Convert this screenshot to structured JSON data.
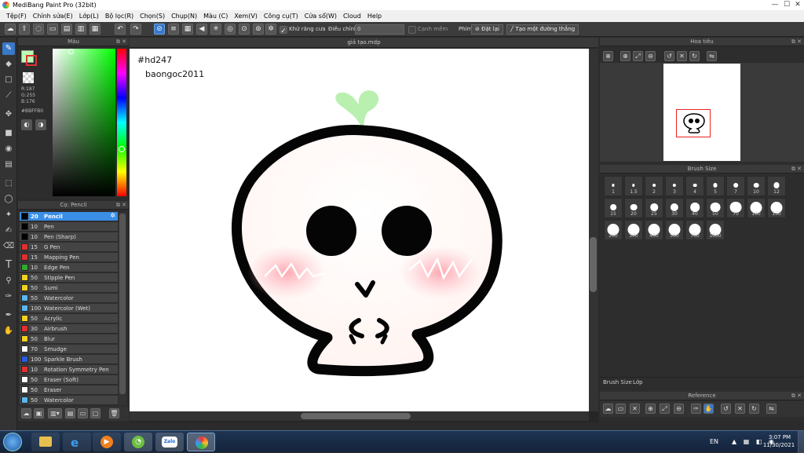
{
  "window": {
    "title": "MediBang Paint Pro (32bit)",
    "controls": [
      "—",
      "☐",
      "✕"
    ]
  },
  "menu": [
    "Tệp(F)",
    "Chỉnh sửa(E)",
    "Lớp(L)",
    "Bộ lọc(R)",
    "Chọn(S)",
    "Chụp(N)",
    "Màu (C)",
    "Xem(V)",
    "Công cụ(T)",
    "Cửa sổ(W)",
    "Cloud",
    "Help"
  ],
  "toolbar": {
    "antialias_label": "Khử răng cưa",
    "adjust_label": "Điều chỉnh",
    "adjust_value": "0",
    "edge_label": "Cạnh mềm",
    "key_label": "Phím",
    "reset_label": "Đặt lại",
    "straight_line_label": "Tạo một đường thẳng"
  },
  "color_panel": {
    "title": "Màu",
    "r": "R:187",
    "g": "G:255",
    "b": "B:176",
    "hex": "#BBFFB0",
    "fg_color": "#BBFFB0",
    "bg_color": "#ffffff"
  },
  "brush_panel": {
    "title": "Cọ: Pencil",
    "items": [
      {
        "size": "20",
        "name": "Pencil",
        "color": "#000000"
      },
      {
        "size": "10",
        "name": "Pen",
        "color": "#000000"
      },
      {
        "size": "10",
        "name": "Pen (Sharp)",
        "color": "#000000"
      },
      {
        "size": "15",
        "name": "G Pen",
        "color": "#e23030"
      },
      {
        "size": "15",
        "name": "Mapping Pen",
        "color": "#e23030"
      },
      {
        "size": "10",
        "name": "Edge Pen",
        "color": "#2eaa2e"
      },
      {
        "size": "50",
        "name": "Stipple Pen",
        "color": "#f0d020"
      },
      {
        "size": "50",
        "name": "Sumi",
        "color": "#f0d020"
      },
      {
        "size": "50",
        "name": "Watercolor",
        "color": "#5ab8f0"
      },
      {
        "size": "100",
        "name": "Watercolor (Wet)",
        "color": "#5ab8f0"
      },
      {
        "size": "50",
        "name": "Acrylic",
        "color": "#f0d020"
      },
      {
        "size": "30",
        "name": "Airbrush",
        "color": "#e23030"
      },
      {
        "size": "50",
        "name": "Blur",
        "color": "#f0d020"
      },
      {
        "size": "70",
        "name": "Smudge",
        "color": "#ffffff"
      },
      {
        "size": "100",
        "name": "Sparkle Brush",
        "color": "#2a5ae0"
      },
      {
        "size": "10",
        "name": "Rotation Symmetry Pen",
        "color": "#e23030"
      },
      {
        "size": "50",
        "name": "Eraser (Soft)",
        "color": "#ffffff"
      },
      {
        "size": "50",
        "name": "Eraser",
        "color": "#ffffff"
      },
      {
        "size": "50",
        "name": "Watercolor",
        "color": "#5ab8f0"
      }
    ]
  },
  "canvas": {
    "tab": "giả tạo.mdp",
    "text1": "#hd247",
    "text2": "baongoc2011"
  },
  "navigator": {
    "title": "Hoa tiêu"
  },
  "brush_size": {
    "title": "Brush Size",
    "sizes": [
      "1",
      "1.5",
      "2",
      "3",
      "4",
      "5",
      "7",
      "10",
      "12",
      "15",
      "20",
      "25",
      "30",
      "40",
      "50",
      "70",
      "100",
      "150",
      "200",
      "300",
      "400",
      "500",
      "700",
      "1000"
    ],
    "tabs": [
      "Brush Size",
      "Lớp"
    ]
  },
  "reference": {
    "title": "Reference"
  },
  "taskbar": {
    "lang": "EN",
    "time": "3:07 PM",
    "date": "11/30/2021",
    "zalo": "Zalo"
  }
}
